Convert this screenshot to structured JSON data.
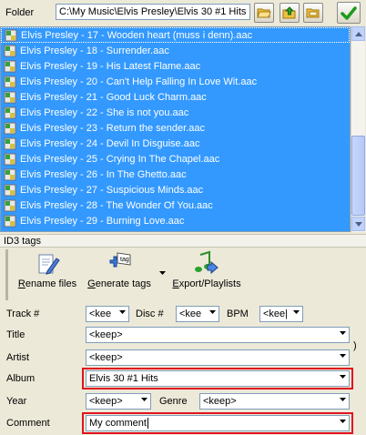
{
  "folder": {
    "label": "Folder",
    "path": "C:\\My Music\\Elvis Presley\\Elvis 30 #1 Hits"
  },
  "toolbar_icons": [
    "open-folder-icon",
    "up-folder-icon",
    "browse-folder-icon",
    "apply-check-icon"
  ],
  "files": [
    "Elvis Presley - 17 - Wooden heart (muss i denn).aac",
    "Elvis Presley - 18 - Surrender.aac",
    "Elvis Presley - 19 - His Latest Flame.aac",
    "Elvis Presley - 20 - Can't Help Falling In Love Wit.aac",
    "Elvis Presley - 21 - Good Luck Charm.aac",
    "Elvis Presley - 22 - She is not you.aac",
    "Elvis Presley - 23 - Return the sender.aac",
    "Elvis Presley - 24 - Devil In Disguise.aac",
    "Elvis Presley - 25 - Crying In The Chapel.aac",
    "Elvis Presley - 26 - In The Ghetto.aac",
    "Elvis Presley - 27 - Suspicious Minds.aac",
    "Elvis Presley - 28 - The Wonder Of You.aac",
    "Elvis Presley - 29 - Burning Love.aac"
  ],
  "id3": {
    "section_title": "ID3 tags",
    "tools": {
      "rename_first": "R",
      "rename_rest": "ename files",
      "generate_first": "G",
      "generate_rest": "enerate tags",
      "export_first": "E",
      "export_rest": "xport/Playlists"
    },
    "labels": {
      "track": "Track #",
      "disc": "Disc #",
      "bpm": "BPM",
      "title": "Title",
      "artist": "Artist",
      "album": "Album",
      "year": "Year",
      "genre": "Genre",
      "comment": "Comment"
    },
    "values": {
      "track": "<kee",
      "disc": "<kee",
      "bpm": "<kee|",
      "title": "<keep>",
      "artist": "<keep>",
      "album": "Elvis 30 #1 Hits",
      "year": "<keep>",
      "genre": "<keep>",
      "comment": "My comment"
    },
    "bracket": ")"
  },
  "colors": {
    "selection": "#3399ff",
    "highlight_border": "#e0141e"
  }
}
